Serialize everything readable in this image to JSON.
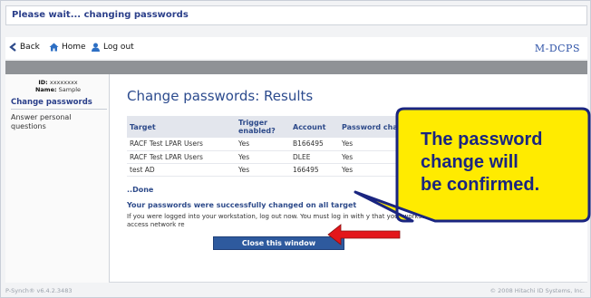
{
  "window": {
    "title": "Please wait... changing passwords"
  },
  "nav": {
    "back": "Back",
    "home": "Home",
    "logout": "Log out",
    "brand": "M-DCPS"
  },
  "sidebar": {
    "id_label": "ID:",
    "id_value": "xxxxxxxx",
    "name_label": "Name:",
    "name_value": "Sample",
    "items": [
      {
        "label": "Change passwords"
      },
      {
        "label": "Answer personal questions"
      }
    ]
  },
  "main": {
    "title": "Change passwords: Results",
    "table": {
      "headers": [
        "Target",
        "Trigger enabled?",
        "Account",
        "Password changed?"
      ],
      "rows": [
        [
          "RACF Test LPAR Users",
          "Yes",
          "B166495",
          "Yes"
        ],
        [
          "RACF Test LPAR Users",
          "Yes",
          "DLEE",
          "Yes"
        ],
        [
          "test AD",
          "Yes",
          "166495",
          "Yes"
        ]
      ]
    },
    "done": "..Done",
    "success": "Your passwords were successfully changed on all target",
    "info": "If you were logged into your workstation, log out now. You must log in with y that your workstation does not try to use your old password to access network re",
    "close_button": "Close this window"
  },
  "footer": {
    "version": "P-Synch® v6.4.2.3483",
    "copyright": "© 2008 Hitachi ID Systems, Inc."
  },
  "callout": {
    "lines": [
      "The password",
      "change will",
      "be confirmed."
    ],
    "fill": "#ffeb00",
    "border": "#1a2580",
    "arrow_color": "#e3161b"
  }
}
